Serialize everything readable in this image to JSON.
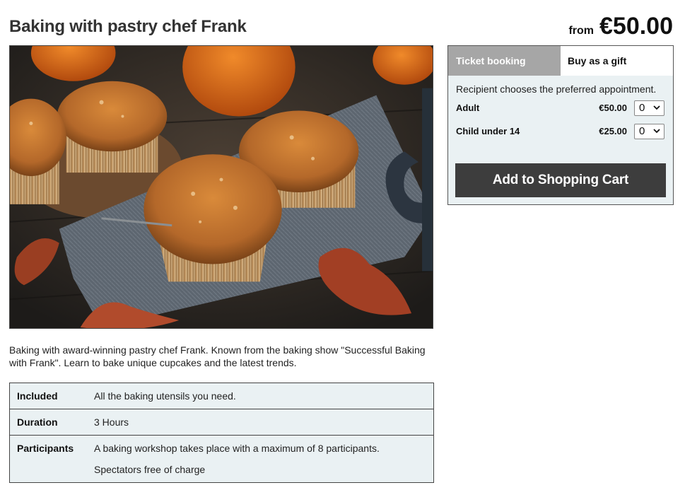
{
  "product": {
    "title": "Baking with pastry chef Frank",
    "price_prefix": "from",
    "price": "€50.00",
    "description": "Baking with award-winning pastry chef Frank. Known from the baking show \"Successful Baking with Frank\". Learn to bake unique cupcakes and the latest trends."
  },
  "details": [
    {
      "label": "Included",
      "values": [
        "All the baking utensils you need."
      ]
    },
    {
      "label": "Duration",
      "values": [
        "3 Hours"
      ]
    },
    {
      "label": "Participants",
      "values": [
        "A baking workshop takes place with a maximum of 8 participants.",
        "Spectators free of charge"
      ]
    }
  ],
  "booking": {
    "tabs": [
      {
        "label": "Ticket booking",
        "active": true
      },
      {
        "label": "Buy as a gift",
        "active": false
      }
    ],
    "note": "Recipient chooses the preferred appointment.",
    "tickets": [
      {
        "name": "Adult",
        "price": "€50.00",
        "qty": "0"
      },
      {
        "name": "Child under 14",
        "price": "€25.00",
        "qty": "0"
      }
    ],
    "cart_label": "Add to Shopping Cart"
  },
  "colors": {
    "panel_bg": "#eaf1f3",
    "active_tab_bg": "#a6a6a6",
    "cart_button_bg": "#3d3d3d"
  }
}
